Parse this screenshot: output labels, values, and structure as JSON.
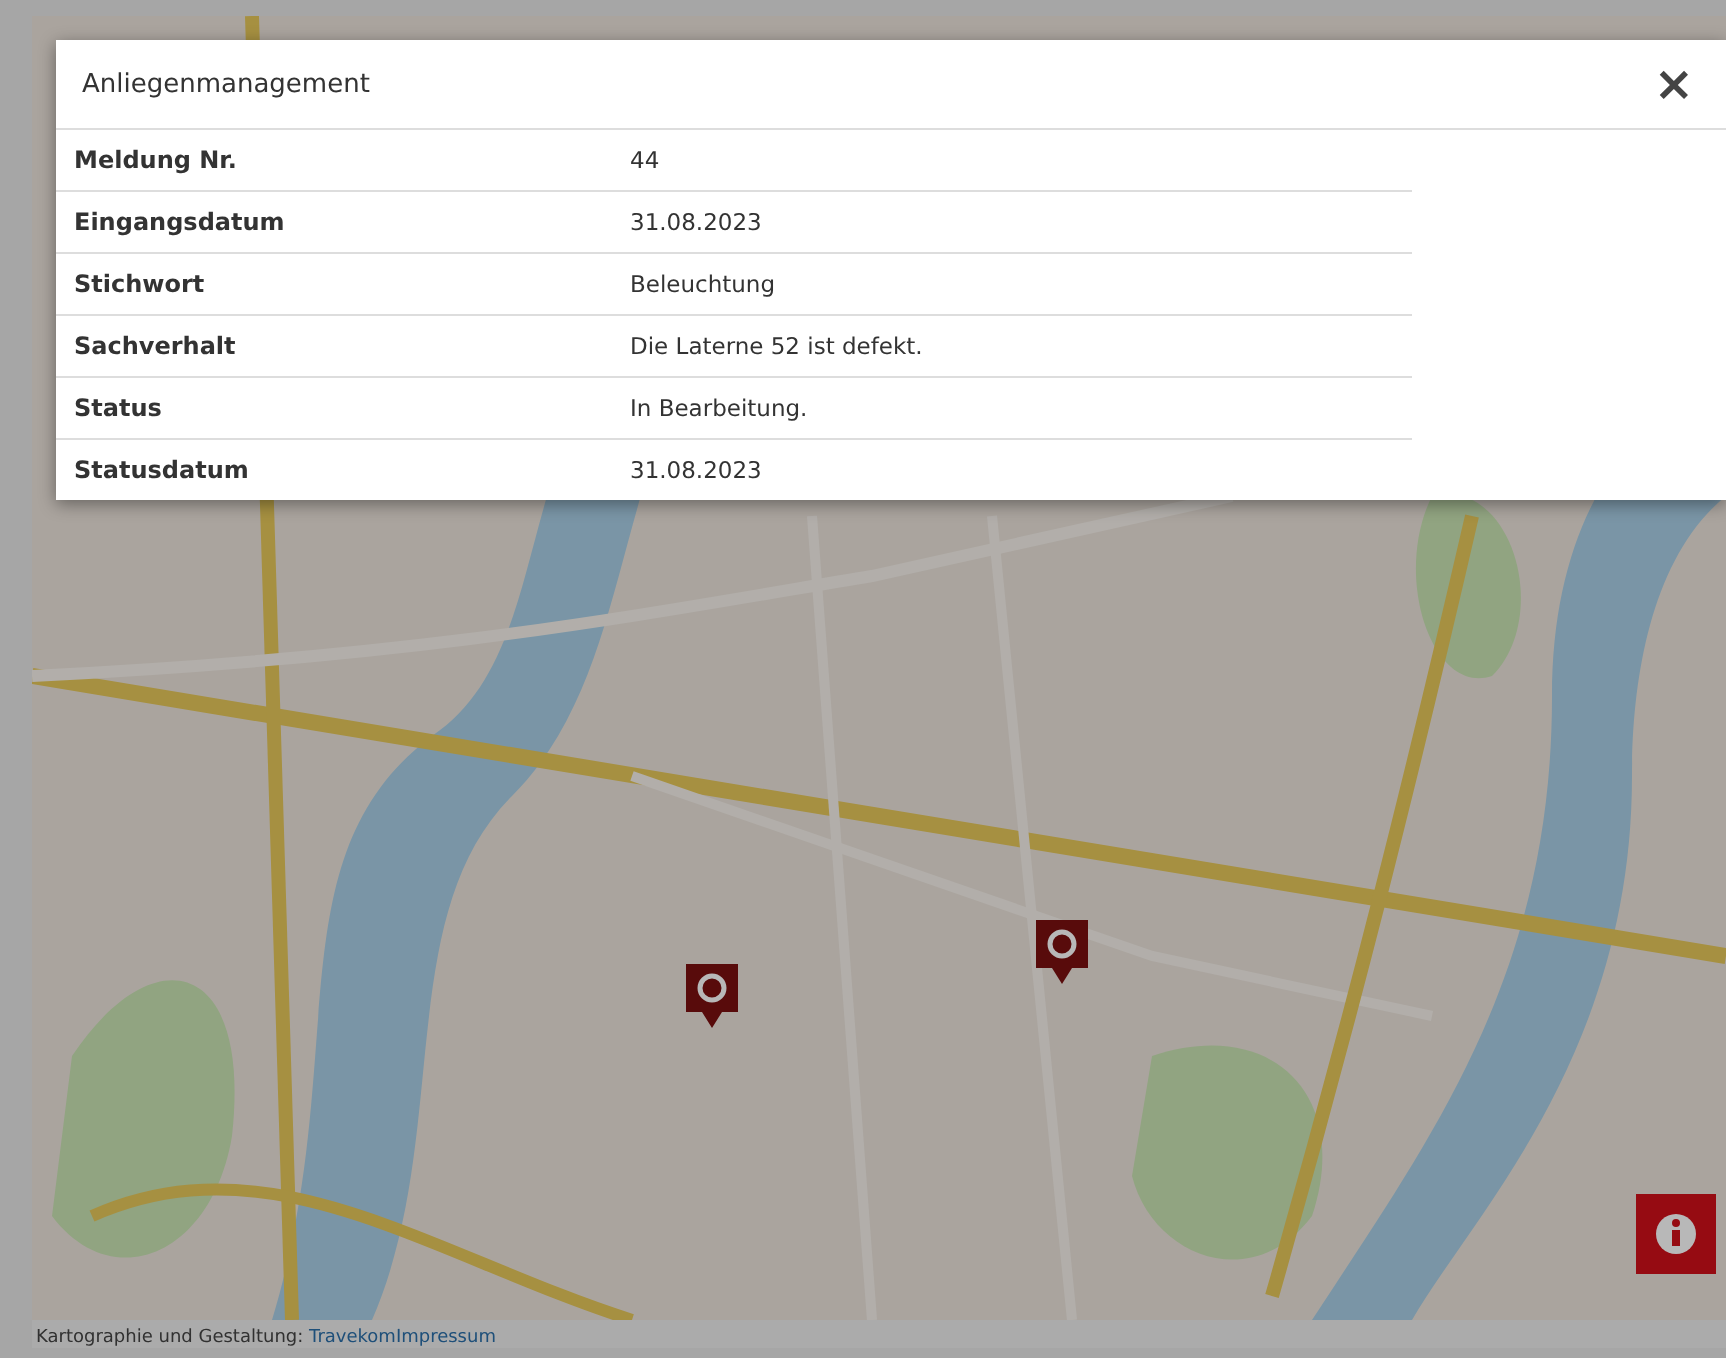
{
  "dialog": {
    "title": "Anliegenmanagement",
    "close": "×",
    "rows": [
      {
        "label": "Meldung Nr.",
        "value": "44"
      },
      {
        "label": "Eingangsdatum",
        "value": "31.08.2023"
      },
      {
        "label": "Stichwort",
        "value": "Beleuchtung"
      },
      {
        "label": "Sachverhalt",
        "value": "Die Laterne 52 ist defekt."
      },
      {
        "label": "Status",
        "value": "In Bearbeitung."
      },
      {
        "label": "Statusdatum",
        "value": "31.08.2023"
      }
    ]
  },
  "footer": {
    "text": "Kartographie und Gestaltung: ",
    "links": [
      "Travekom",
      "Impressum"
    ]
  }
}
